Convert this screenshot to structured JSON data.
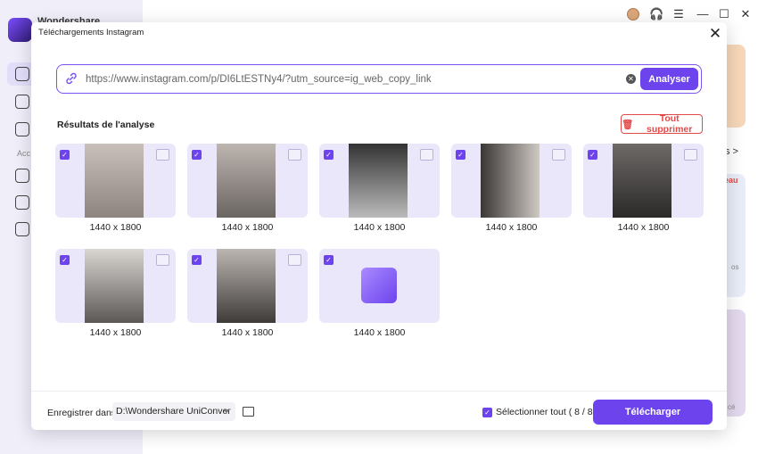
{
  "app": {
    "logo_text": "Wondershare"
  },
  "sidebar": {
    "section_label": "Acc"
  },
  "background": {
    "link_text": "s >",
    "badge_text": "eau",
    "side_text_1": "os",
    "side_text_2": "cé"
  },
  "modal": {
    "title": "Téléchargements Instagram",
    "close_icon": "close-icon",
    "url": {
      "value": "https://www.instagram.com/p/DI6LtESTNy4/?utm_source=ig_web_copy_link",
      "clear_icon": "clear-icon",
      "analyse_label": "Analyser"
    },
    "results_title": "Résultats de l'analyse",
    "delete_all_label": "Tout supprimer",
    "items": [
      {
        "resolution": "1440 x 1800",
        "checked": true
      },
      {
        "resolution": "1440 x 1800",
        "checked": true
      },
      {
        "resolution": "1440 x 1800",
        "checked": true
      },
      {
        "resolution": "1440 x 1800",
        "checked": true
      },
      {
        "resolution": "1440 x 1800",
        "checked": true
      },
      {
        "resolution": "1440 x 1800",
        "checked": true
      },
      {
        "resolution": "1440 x 1800",
        "checked": true
      },
      {
        "resolution": "1440 x 1800",
        "checked": true
      }
    ],
    "footer": {
      "save_label": "Enregistrer dans",
      "save_path": "D:\\Wondershare UniConver",
      "select_all_label": "Sélectionner tout ( 8 / 8 )",
      "download_label": "Télécharger"
    }
  },
  "colors": {
    "accent": "#6d43ee",
    "danger": "#e24a4a",
    "card_bg": "#ebe7fb"
  }
}
